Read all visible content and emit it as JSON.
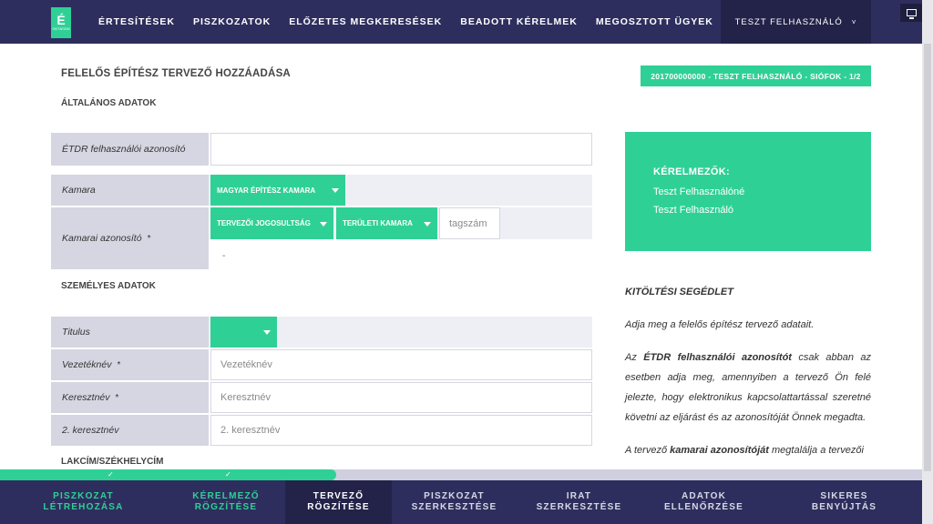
{
  "logo": {
    "letter": "É",
    "sub": "OKTATÁSI"
  },
  "nav": [
    "ÉRTESÍTÉSEK",
    "PISZKOZATOK",
    "ELŐZETES MEGKERESÉSEK",
    "BEADOTT KÉRELMEK",
    "MEGOSZTOTT ÜGYEK"
  ],
  "user": {
    "name": "TESZT FELHASZNÁLÓ",
    "chevron": "˅"
  },
  "page_title": "FELELŐS ÉPÍTÉSZ TERVEZŐ HOZZÁADÁSA",
  "ident_badge": "201700000000 - TESZT FELHASZNÁLÓ - SIÓFOK - 1/2",
  "sections": {
    "general": "ÁLTALÁNOS ADATOK",
    "personal": "SZEMÉLYES ADATOK",
    "address": "LAKCÍM/SZÉKHELYCÍM"
  },
  "form": {
    "etdr_label": "ÉTDR felhasználói azonosító",
    "etdr_value": "",
    "kamara_label": "Kamara",
    "kamara_value": "MAGYAR ÉPÍTÉSZ KAMARA",
    "kamarai_label": "Kamarai azonosító",
    "kamarai_req": "*",
    "jogosultsag_value": "TERVEZŐI JOGOSULTSÁG",
    "teruleti_value": "TERÜLETI KAMARA",
    "tagszam_placeholder": "tagszám",
    "dash": "-",
    "titulus_label": "Titulus",
    "titulus_value": "",
    "vezeteknev_label": "Vezetéknév",
    "vezeteknev_req": "*",
    "vezeteknev_placeholder": "Vezetéknév",
    "keresztnev_label": "Keresztnév",
    "keresztnev_req": "*",
    "keresztnev_placeholder": "Keresztnév",
    "keresztnev2_label": "2. keresztnév",
    "keresztnev2_placeholder": "2. keresztnév"
  },
  "applicants": {
    "heading": "KÉRELMEZŐK:",
    "names": [
      "Teszt Felhasználóné",
      "Teszt Felhasználó"
    ]
  },
  "helper": {
    "title": "KITÖLTÉSI SEGÉDLET",
    "p1": "Adja meg a felelős építész tervező adatait.",
    "p2_a": "Az ",
    "p2_b": "ÉTDR felhasználói azonosítót",
    "p2_c": " csak abban az esetben adja meg, amennyiben a tervező Ön felé jelezte, hogy elektronikus kapcsolattartással szeretné követni az eljárást és az azonosítóját Önnek megadta.",
    "p3_a": "A tervező ",
    "p3_b": "kamarai azonosítóját",
    "p3_c": " megtalálja a tervezői"
  },
  "progress": {
    "fraction": 0.365,
    "check_mark": "✓"
  },
  "steps": [
    {
      "line1": "PISZKOZAT",
      "line2": "LÉTREHOZÁSA",
      "state": "done"
    },
    {
      "line1": "KÉRELMEZŐ",
      "line2": "RÖGZÍTÉSE",
      "state": "done"
    },
    {
      "line1": "TERVEZŐ",
      "line2": "RÖGZÍTÉSE",
      "state": "active"
    },
    {
      "line1": "PISZKOZAT",
      "line2": "SZERKESZTÉSE",
      "state": "todo"
    },
    {
      "line1": "IRAT",
      "line2": "SZERKESZTÉSE",
      "state": "todo"
    },
    {
      "line1": "ADATOK",
      "line2": "ELLENŐRZÉSE",
      "state": "todo"
    },
    {
      "line1": "SIKERES",
      "line2": "BENYÚJTÁS",
      "state": "todo"
    }
  ],
  "colors": {
    "accent": "#2fd096",
    "nav_bg": "#2e2e5e",
    "nav_dark": "#232349"
  },
  "icons": {
    "monitor": "monitor-icon",
    "dropdown": "caret-down-icon",
    "check": "check-icon"
  }
}
